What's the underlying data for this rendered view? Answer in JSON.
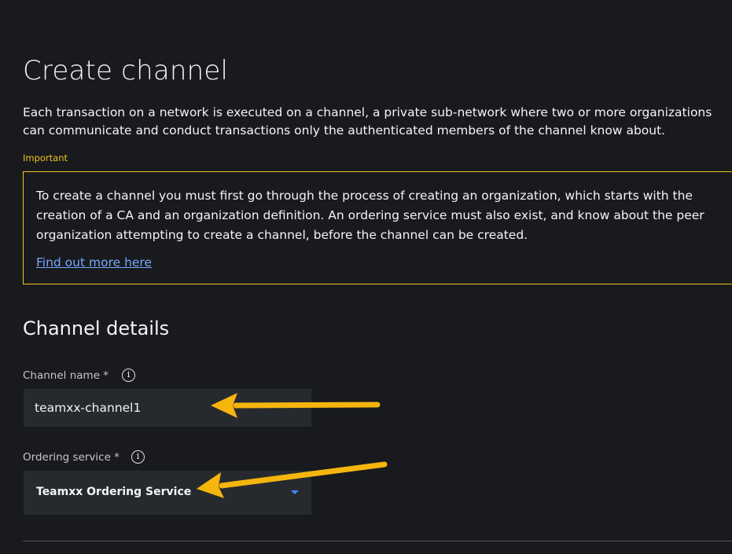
{
  "page": {
    "title": "Create channel",
    "intro": "Each transaction on a network is executed on a channel, a private sub-network where two or more organizations can communicate and conduct transactions only the authenticated members of the channel know about."
  },
  "notice": {
    "label": "Important",
    "text": "To create a channel you must first go through the process of creating an organization, which starts with the creation of a CA and an organization definition. An ordering service must also exist, and know about the peer organization attempting to create a channel, before the channel can be created.",
    "link_label": "Find out more here",
    "border_color": "#f1c21b"
  },
  "channel_details": {
    "title": "Channel details",
    "channel_name": {
      "label": "Channel name *",
      "value": "teamxx-channel1",
      "icon": "info-icon"
    },
    "ordering_service": {
      "label": "Ordering service *",
      "selected": "Teamxx Ordering Service",
      "icon": "info-icon"
    }
  },
  "annotations": {
    "arrow_color": "#f5b50d"
  }
}
